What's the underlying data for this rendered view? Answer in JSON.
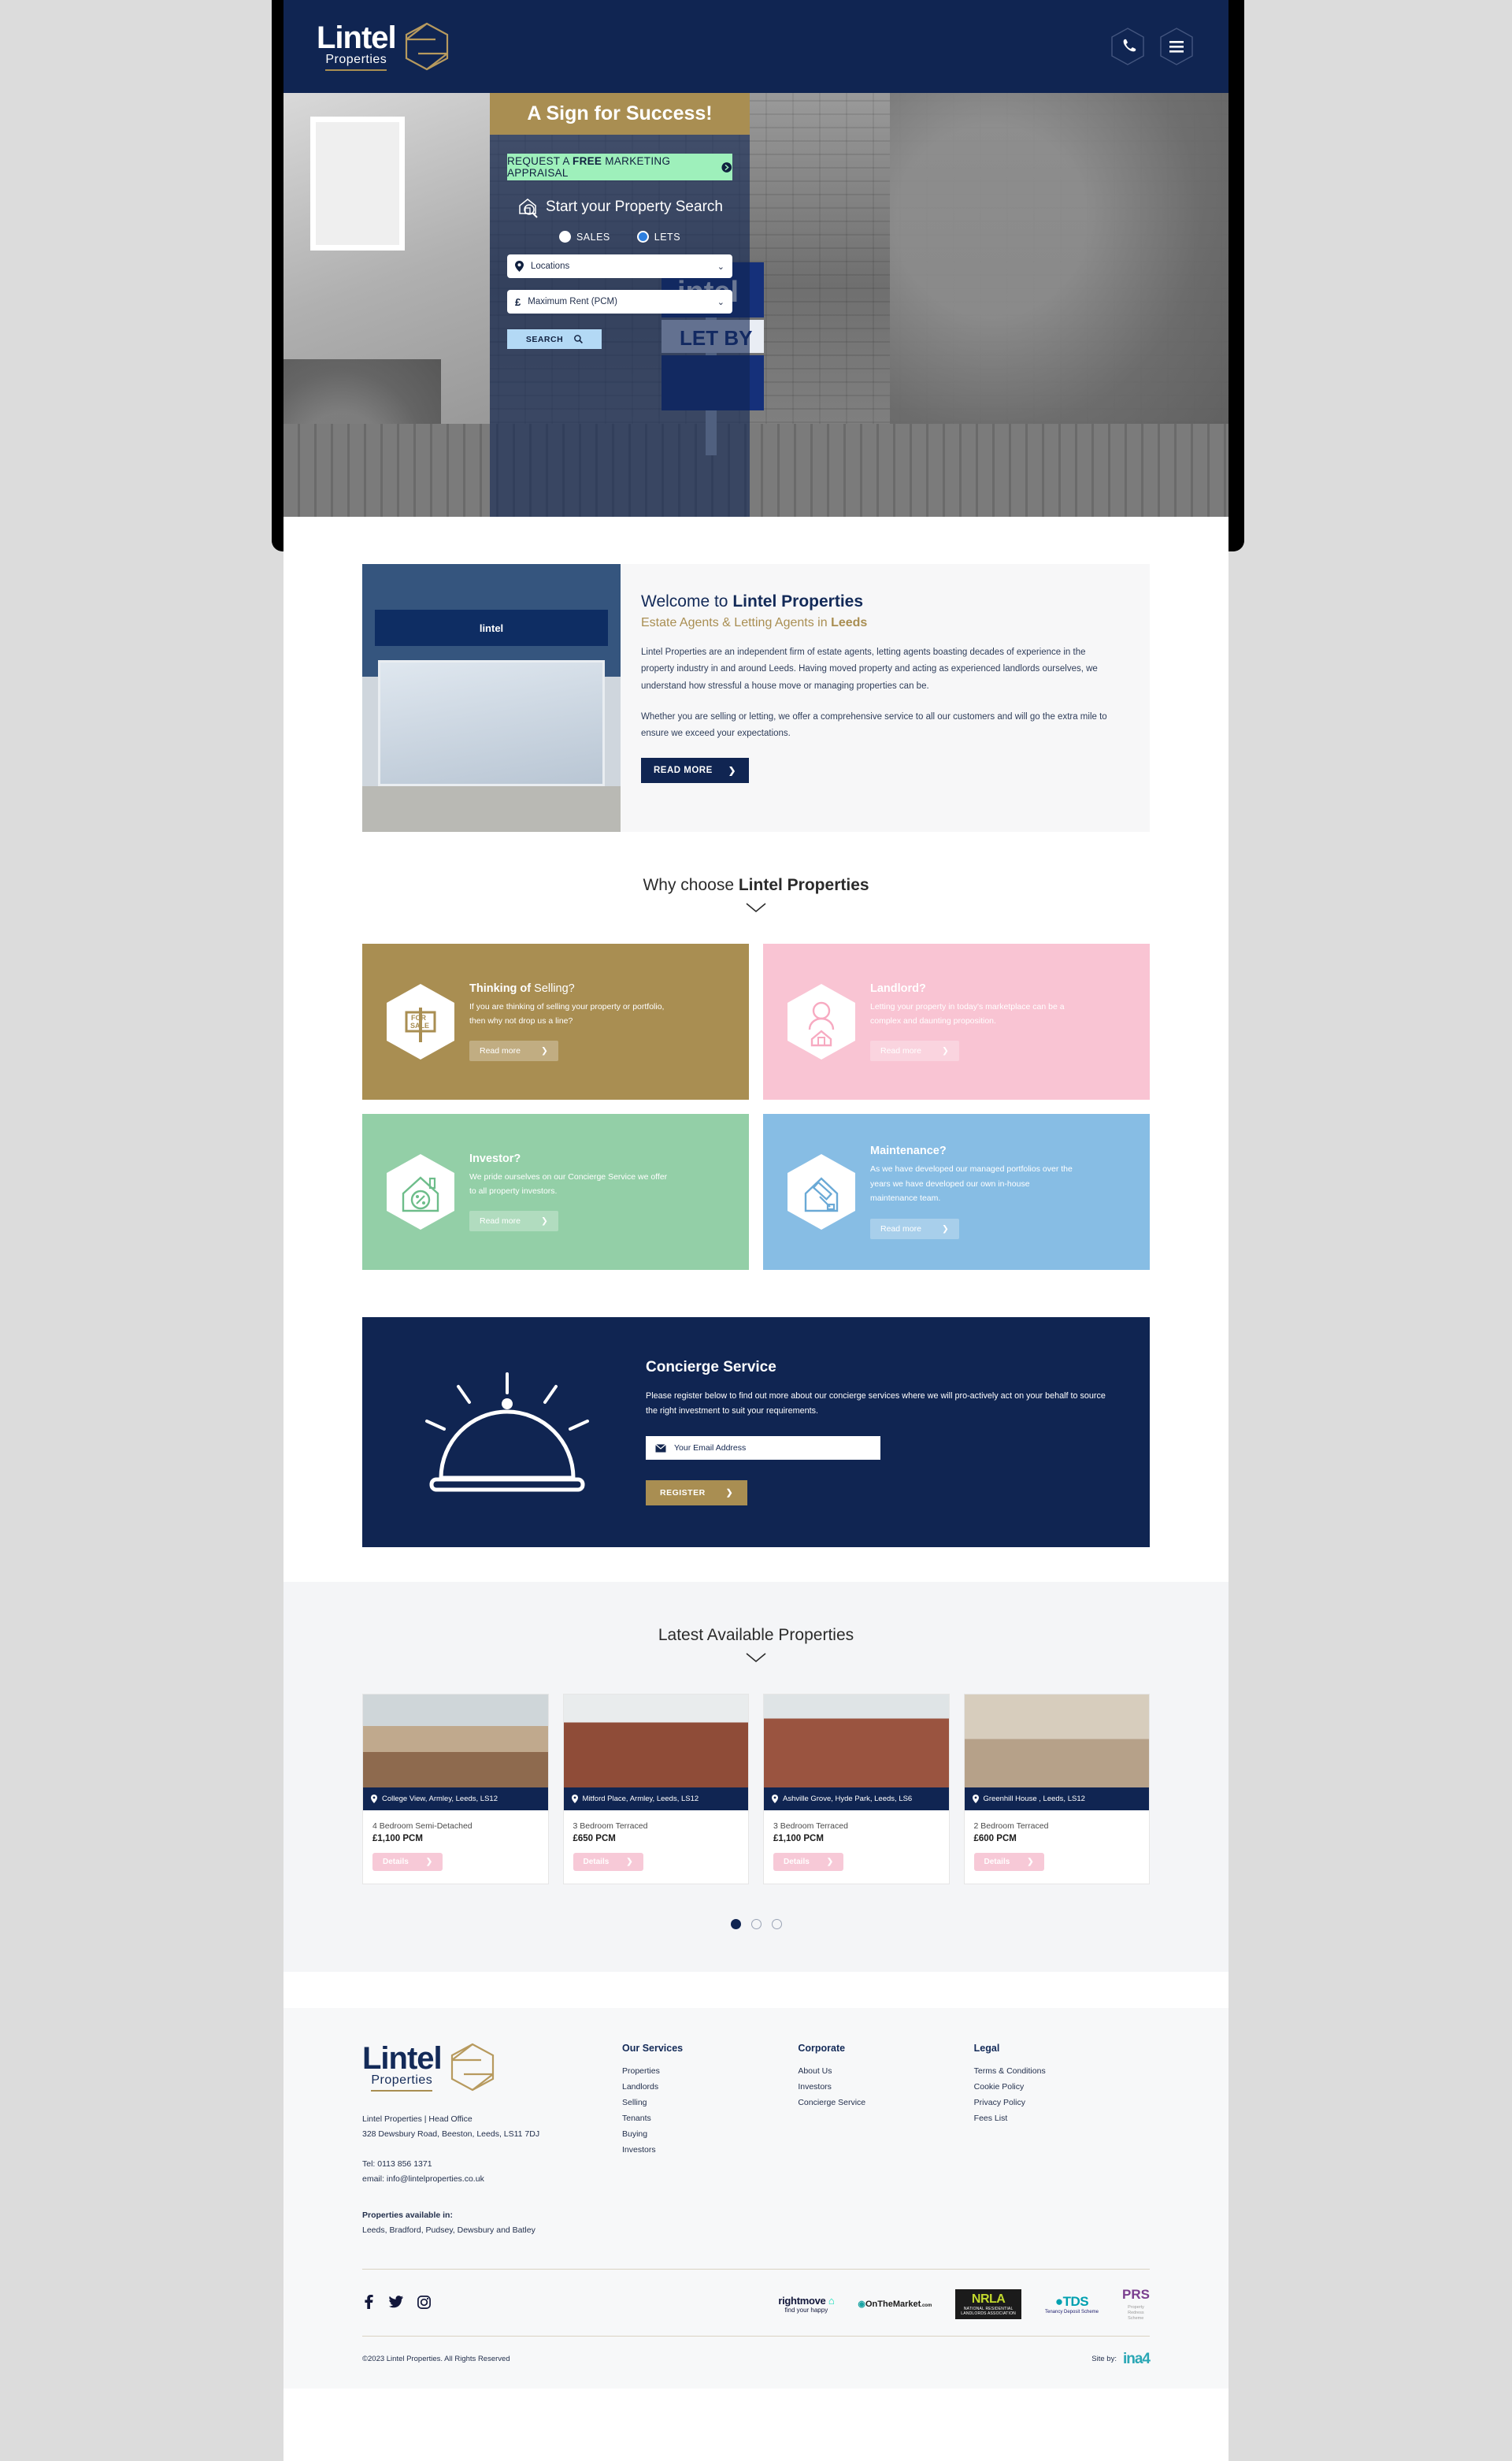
{
  "brand": {
    "name": "Lintel",
    "sub": "Properties",
    "mark": "hexagon-logo"
  },
  "header": {
    "phone_icon": "phone-icon",
    "menu_icon": "hamburger-menu-icon"
  },
  "hero": {
    "title": "A Sign for Success!",
    "appraisal_pre": "REQUEST A ",
    "appraisal_bold": "FREE",
    "appraisal_post": " MARKETING APPRAISAL",
    "search_heading": "Start your Property Search",
    "radio_sales": "SALES",
    "radio_lets": "LETS",
    "selected_radio": "LETS",
    "location_placeholder": "Locations",
    "rent_placeholder": "Maximum Rent (PCM)",
    "rent_symbol": "£",
    "search_button": "SEARCH"
  },
  "welcome": {
    "heading_pre": "Welcome to ",
    "heading_bold": "Lintel Properties",
    "sub_pre": "Estate Agents & Letting Agents in ",
    "sub_bold": "Leeds",
    "paragraph1": "Lintel Properties are an independent firm of estate agents, letting agents boasting decades of experience in the property industry in and around Leeds. Having moved property and acting as experienced landlords ourselves, we understand how stressful a house move or managing properties can be.",
    "paragraph2": "Whether you are selling or letting, we offer a comprehensive service to all our customers and will go the extra mile to ensure we exceed your expectations.",
    "read_more": "READ MORE",
    "shop_sign": "lintel"
  },
  "why_choose": {
    "heading_pre": "Why choose ",
    "heading_bold": "Lintel Properties",
    "cards": [
      {
        "title_bold": "Thinking of ",
        "title_rest": "Selling?",
        "body": "If you are thinking of selling your property or portfolio, then why not drop us a line?",
        "button": "Read more",
        "icon": "for-sale-sign-icon",
        "color": "#a98e52"
      },
      {
        "title_bold": "Landlord?",
        "title_rest": "",
        "body": "Letting your property in today's marketplace can be a complex and daunting proposition.",
        "button": "Read more",
        "icon": "landlord-person-icon",
        "color": "#f9c4d3"
      },
      {
        "title_bold": "Investor?",
        "title_rest": "",
        "body": "We pride ourselves on our Concierge Service we offer to all property investors.",
        "button": "Read more",
        "icon": "house-percent-icon",
        "color": "#93cfa7"
      },
      {
        "title_bold": "Maintenance?",
        "title_rest": "",
        "body": "As we have developed our managed portfolios over the years we have developed our own in-house maintenance team.",
        "button": "Read more",
        "icon": "paint-roller-house-icon",
        "color": "#87bde4"
      }
    ]
  },
  "concierge": {
    "title": "Concierge Service",
    "body": "Please register below to find out more about our concierge services where we will pro-actively act on your behalf to source the right investment to suit your requirements.",
    "email_placeholder": "Your Email Address",
    "email_icon": "envelope-icon",
    "register_button": "REGISTER",
    "bell_icon": "concierge-bell-icon"
  },
  "latest": {
    "heading": "Latest Available Properties",
    "details_label": "Details",
    "properties": [
      {
        "address": "College View, Armley, Leeds, LS12",
        "type": "4 Bedroom Semi-Detached",
        "price": "£1,100 PCM"
      },
      {
        "address": "Mitford Place, Armley, Leeds, LS12",
        "type": "3 Bedroom Terraced",
        "price": "£650 PCM"
      },
      {
        "address": "Ashville Grove, Hyde Park, Leeds, LS6",
        "type": "3 Bedroom Terraced",
        "price": "£1,100 PCM"
      },
      {
        "address": "Greenhill House , Leeds, LS12",
        "type": "2 Bedroom Terraced",
        "price": "£600 PCM"
      }
    ],
    "dots": 3,
    "active_dot": 0
  },
  "footer": {
    "office_line1": "Lintel Properties | Head Office",
    "office_line2": "328 Dewsbury Road, Beeston, Leeds, LS11 7DJ",
    "tel": "Tel: 0113 856 1371",
    "email": "email: info@lintelproperties.co.uk",
    "available_label": "Properties available in:",
    "available_places": "Leeds, Bradford, Pudsey, Dewsbury and Batley",
    "columns": [
      {
        "title": "Our Services",
        "links": [
          "Properties",
          "Landlords",
          "Selling",
          "Tenants",
          "Buying",
          "Investors"
        ]
      },
      {
        "title": "Corporate",
        "links": [
          "About Us",
          "Investors",
          "Concierge Service"
        ]
      },
      {
        "title": "Legal",
        "links": [
          "Terms & Conditions",
          "Cookie Policy",
          "Privacy Policy",
          "Fees List"
        ]
      }
    ],
    "socials": [
      "facebook-icon",
      "twitter-icon",
      "instagram-icon"
    ],
    "partners": {
      "rightmove": "rightmove",
      "rightmove_sub": "find your happy",
      "onthemarket": "OnTheMarket",
      "onthemarket_sub": ".com",
      "nrla": "NRLA",
      "nrla_sub1": "NATIONAL RESIDENTIAL",
      "nrla_sub2": "LANDLORDS ASSOCIATION",
      "tds": "TDS",
      "tds_sub": "Tenancy Deposit Scheme",
      "prs": "PRS",
      "prs_sub1": "Property",
      "prs_sub2": "Redress",
      "prs_sub3": "Scheme"
    },
    "copyright": "©2023 Lintel Properties. All Rights Reserved",
    "site_by_label": "Site by:",
    "site_by_name": "ina4"
  }
}
